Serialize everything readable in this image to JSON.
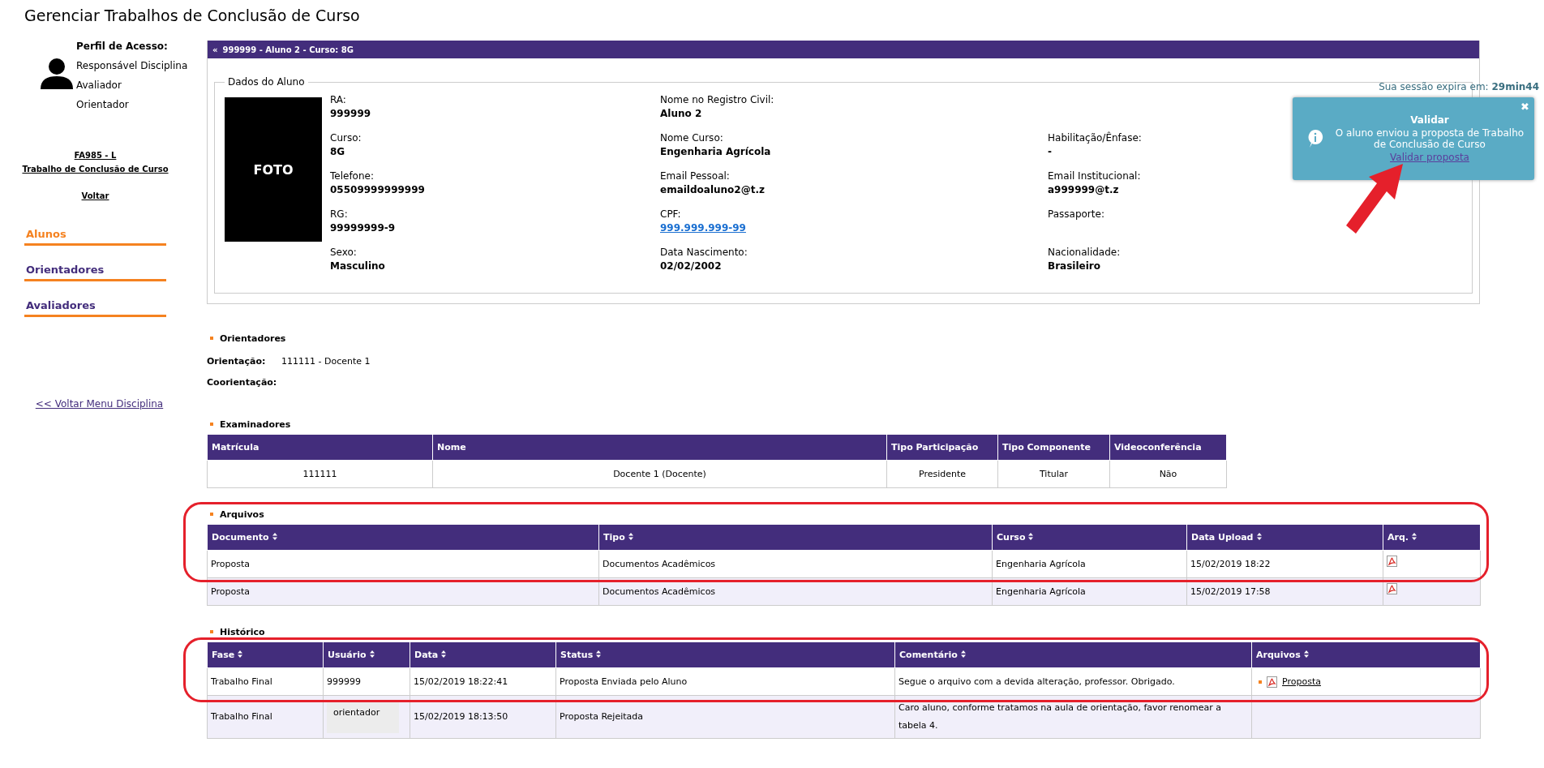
{
  "page_title": "Gerenciar Trabalhos de Conclusão de Curso",
  "sidebar": {
    "profile_label": "Perfil de Acesso:",
    "profiles": [
      "Responsável Disciplina",
      "Avaliador",
      "Orientador"
    ],
    "course_code": "FA985 - L",
    "course_name": "Trabalho de Conclusão de Curso",
    "back": "Voltar",
    "nav": [
      {
        "label": "Alunos",
        "selected": true
      },
      {
        "label": "Orientadores",
        "selected": false
      },
      {
        "label": "Avaliadores",
        "selected": false
      }
    ],
    "back_menu": "<< Voltar Menu Disciplina"
  },
  "student_panel": {
    "header_icon": "«",
    "header": "999999 - Aluno 2 - Curso: 8G",
    "legend": "Dados do Aluno",
    "photo_text": "FOTO",
    "columns": [
      [
        {
          "label": "RA:",
          "value": "999999"
        },
        {
          "label": "Curso:",
          "value": "8G"
        },
        {
          "label": "Telefone:",
          "value": "05509999999999"
        },
        {
          "label": "RG:",
          "value": "99999999-9"
        },
        {
          "label": "Sexo:",
          "value": "Masculino"
        }
      ],
      [
        {
          "label": "Nome no Registro Civil:",
          "value": "Aluno 2"
        },
        {
          "label": "Nome Curso:",
          "value": "Engenharia Agrícola"
        },
        {
          "label": "Email Pessoal:",
          "value": "emaildoaluno2@t.z"
        },
        {
          "label": "CPF:",
          "value": "999.999.999-99",
          "kind": "link"
        },
        {
          "label": "Data Nascimento:",
          "value": "02/02/2002"
        }
      ],
      [
        {
          "kind": "empty"
        },
        {
          "label": "Habilitação/Ênfase:",
          "value": "-"
        },
        {
          "label": "Email Institucional:",
          "value": "a999999@t.z"
        },
        {
          "label": "Passaporte:"
        },
        {
          "label": "Nacionalidade:",
          "value": "Brasileiro"
        }
      ]
    ]
  },
  "session": "Sua sessão expira em: **29min44**",
  "notification": {
    "title": "Validar",
    "message": "O aluno enviou a proposta de Trabalho de Conclusão de Curso",
    "link": "Validar proposta",
    "close": "✖",
    "pointer_arrow": true
  },
  "orientadores": {
    "title": "Orientadores",
    "rows": [
      {
        "label": "Orientação:",
        "value": "111111 - Docente 1"
      },
      {
        "label": "Coorientação:"
      }
    ]
  },
  "examinadores": {
    "title": "Examinadores",
    "columns": [
      "Matrícula",
      "Nome",
      "Tipo Participação",
      "Tipo Componente",
      "Videoconferência"
    ],
    "rows": [
      [
        "111111",
        "Docente 1 (Docente)",
        "Presidente",
        "Titular",
        "Não"
      ]
    ]
  },
  "arquivos": {
    "title": "Arquivos",
    "highlighted": true,
    "columns": [
      "Documento",
      "Tipo",
      "Curso",
      "Data Upload",
      "Arq."
    ],
    "rows": [
      {
        "cells": [
          "Proposta",
          "Documentos Acadêmicos",
          "Engenharia Agrícola",
          "15/02/2019 18:22"
        ],
        "pdf": true
      },
      {
        "cells": [
          "Proposta",
          "Documentos Acadêmicos",
          "Engenharia Agrícola",
          "15/02/2019 17:58"
        ],
        "pdf": true
      }
    ]
  },
  "historico": {
    "title": "Histórico",
    "highlighted": true,
    "columns": [
      "Fase",
      "Usuário",
      "Data",
      "Status",
      "Comentário",
      "Arquivos"
    ],
    "rows": [
      {
        "fase": "Trabalho Final",
        "usuario": "999999",
        "data": "15/02/2019 18:22:41",
        "status": "Proposta Enviada pelo Aluno",
        "comentario": "Segue o arquivo com a devida alteração, professor. Obrigado.",
        "arquivo": "Proposta"
      },
      {
        "fase": "Trabalho Final",
        "usuario": "orientador",
        "usuario_blurred": true,
        "data": "15/02/2019 18:13:50",
        "status": "Proposta Rejeitada",
        "comentario": "Caro aluno, conforme tratamos na aula de orientação, favor renomear a tabela 4."
      }
    ]
  }
}
